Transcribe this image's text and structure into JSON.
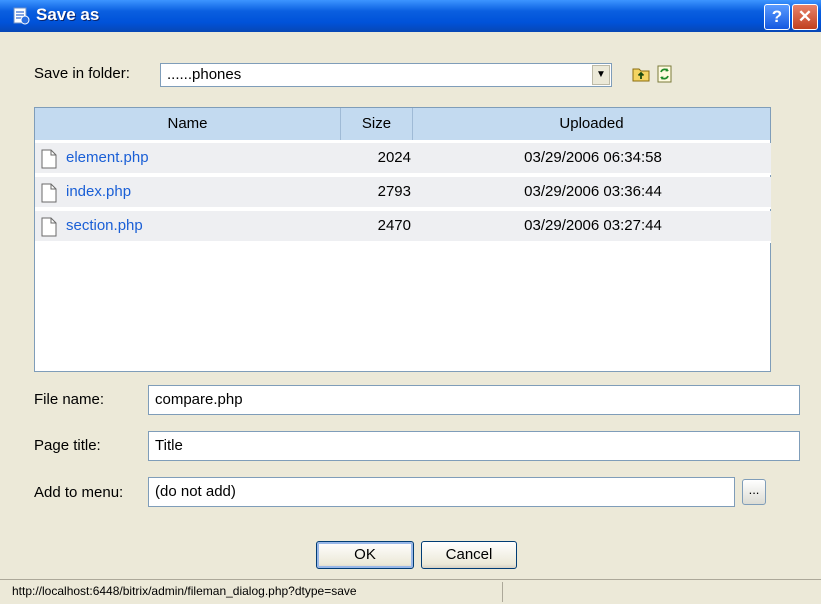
{
  "window": {
    "title": "Save as",
    "help_label": "?",
    "close_label": "✕"
  },
  "folder": {
    "label": "Save in folder:",
    "value": "......phones",
    "dropdown_arrow": "▼"
  },
  "toolbar": {
    "up_icon": "folder-up-icon",
    "refresh_icon": "refresh-icon"
  },
  "file_list": {
    "columns": [
      "Name",
      "Size",
      "Uploaded"
    ],
    "rows": [
      {
        "name": "element.php",
        "size": "2024",
        "uploaded": "03/29/2006 06:34:58"
      },
      {
        "name": "index.php",
        "size": "2793",
        "uploaded": "03/29/2006 03:36:44"
      },
      {
        "name": "section.php",
        "size": "2470",
        "uploaded": "03/29/2006 03:27:44"
      }
    ]
  },
  "form": {
    "file_name_label": "File name:",
    "file_name_value": "compare.php",
    "page_title_label": "Page title:",
    "page_title_value": "Title",
    "menu_label": "Add to menu:",
    "menu_value": "(do not add)",
    "browse_label": "..."
  },
  "buttons": {
    "ok": "OK",
    "cancel": "Cancel"
  },
  "status": {
    "url": "http://localhost:6448/bitrix/admin/fileman_dialog.php?dtype=save"
  },
  "colors": {
    "titlebar": "#0052d9",
    "header_bg": "#c3daf0",
    "link": "#1a5fd6",
    "row_bg": "#eeeff2"
  }
}
